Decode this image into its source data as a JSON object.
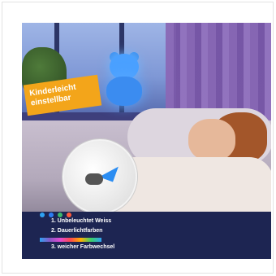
{
  "badge": {
    "line1": "Kinderleicht",
    "line2": "einstellbar"
  },
  "features": [
    "1. Unbeleuchtet Weiss",
    "2. Dauerlichtfarben",
    "3. weicher Farbwechsel"
  ],
  "colors": {
    "dots": [
      "#2ea2f2",
      "#2b7cf2",
      "#3bb86a",
      "#ff5a3c"
    ]
  }
}
